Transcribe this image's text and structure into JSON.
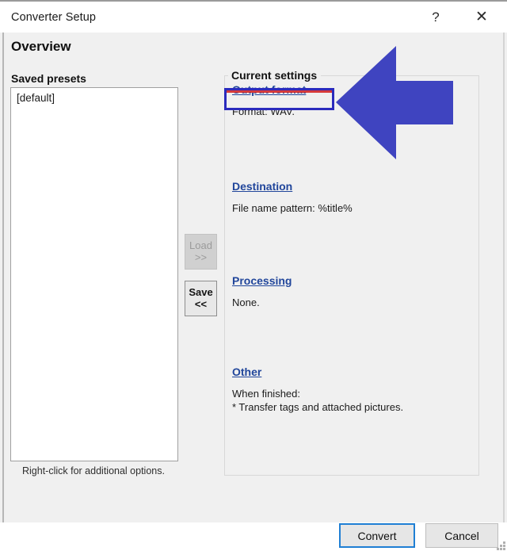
{
  "window": {
    "title": "Converter Setup",
    "help_label": "?",
    "close_label": "✕"
  },
  "page": {
    "heading": "Overview"
  },
  "presets": {
    "label": "Saved presets",
    "items": [
      "[default]"
    ],
    "hint": "Right-click for additional options."
  },
  "transfer_buttons": {
    "load": {
      "line1": "Load",
      "line2": ">>",
      "enabled": false
    },
    "save": {
      "line1": "Save",
      "line2": "<<",
      "enabled": true
    }
  },
  "settings": {
    "legend": "Current settings",
    "sections": [
      {
        "link": "Output format",
        "body": "Format: WAV.",
        "highlighted": true
      },
      {
        "link": "Destination",
        "body": "File name pattern: %title%",
        "highlighted": false
      },
      {
        "link": "Processing",
        "body": "None.",
        "highlighted": false
      },
      {
        "link": "Other",
        "body": "When finished:\n* Transfer tags and attached pictures.",
        "highlighted": false
      }
    ]
  },
  "footer": {
    "convert_label": "Convert",
    "cancel_label": "Cancel"
  },
  "annotation": {
    "type": "left-arrow",
    "color": "#3f44c0",
    "points_at": "Output format"
  },
  "colors": {
    "dialog_background": "#f0f0f0",
    "titlebar_background": "#ffffff",
    "link": "#21469b",
    "highlight_border": "#2b2bbd",
    "highlight_accent": "#d63b3b",
    "focus_border": "#1f7fd4",
    "arrow": "#3f44c0"
  }
}
